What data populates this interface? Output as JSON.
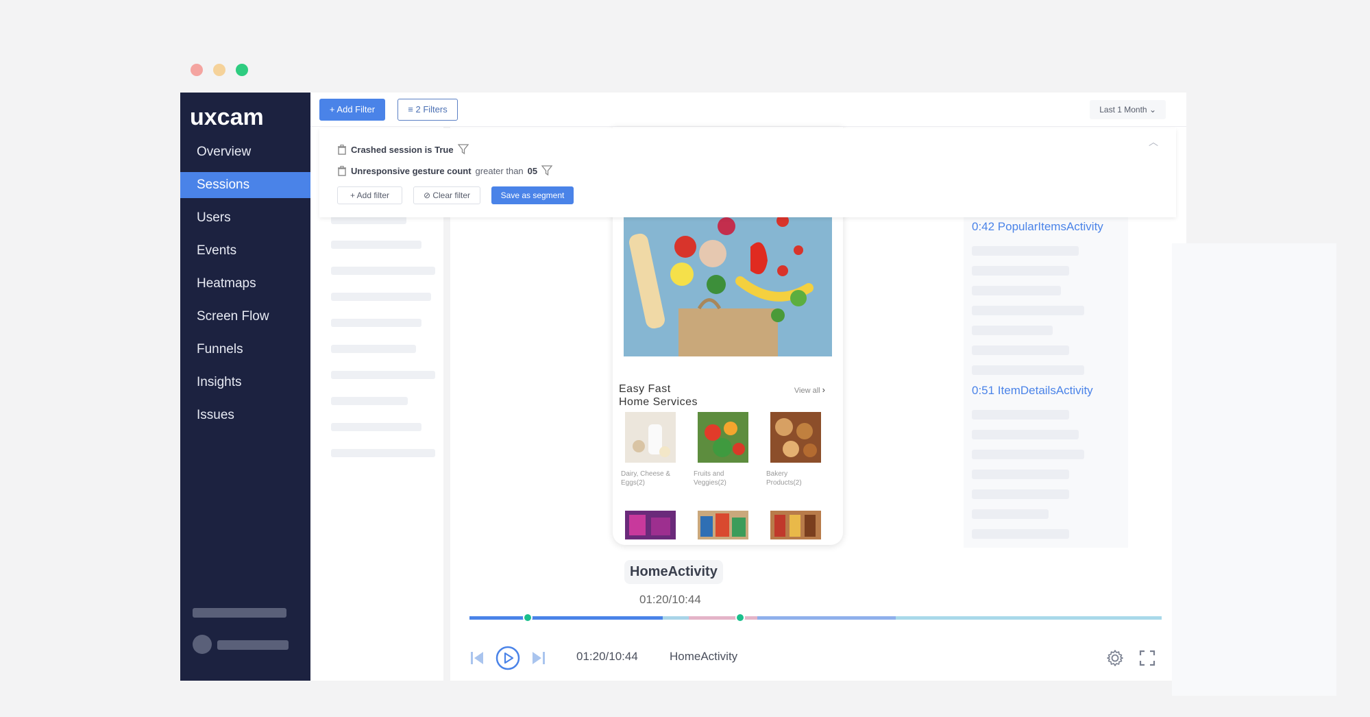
{
  "window": {
    "dot_colors": [
      "#f4a4a0",
      "#f5d29a",
      "#2ecc80"
    ]
  },
  "brand": {
    "logo_text": "uxcam",
    "primary": "#4a83e8",
    "sidebar_bg": "#1c2240"
  },
  "sidebar": {
    "items": [
      {
        "label": "Overview",
        "active": false
      },
      {
        "label": "Sessions",
        "active": true
      },
      {
        "label": "Users",
        "active": false
      },
      {
        "label": "Events",
        "active": false
      },
      {
        "label": "Heatmaps",
        "active": false
      },
      {
        "label": "Screen Flow",
        "active": false
      },
      {
        "label": "Funnels",
        "active": false
      },
      {
        "label": "Insights",
        "active": false
      },
      {
        "label": "Issues",
        "active": false
      }
    ]
  },
  "toolbar": {
    "add_filter": "Add Filter",
    "filters_count": "2 Filters",
    "date_range": "Last 1 Month"
  },
  "filters": {
    "rows": [
      {
        "name": "Crashed session is True",
        "operator": "",
        "value": ""
      },
      {
        "name": "Unresponsive gesture count",
        "operator": "greater than",
        "value": "05"
      }
    ],
    "add_filter": "Add filter",
    "clear_filter": "Clear filter",
    "save_segment": "Save as segment"
  },
  "player": {
    "phone": {
      "title_line1": "Easy Fast",
      "title_line2": "Home Services",
      "view_all": "View all",
      "categories": [
        {
          "label_line1": "Dairy, Cheese &",
          "label_line2": "Eggs(2)"
        },
        {
          "label_line1": "Fruits and",
          "label_line2": "Veggies(2)"
        },
        {
          "label_line1": "Bakery",
          "label_line2": "Products(2)"
        }
      ]
    },
    "activity_name": "HomeActivity",
    "activity_time": "01:20/10:44",
    "controls": {
      "time": "01:20/10:44",
      "activity": "HomeActivity"
    },
    "progress_fraction": 0.28
  },
  "events": {
    "items": [
      {
        "label": "0:42 PopularItemsActivity"
      },
      {
        "label": "0:51 ItemDetailsActivity"
      }
    ]
  }
}
